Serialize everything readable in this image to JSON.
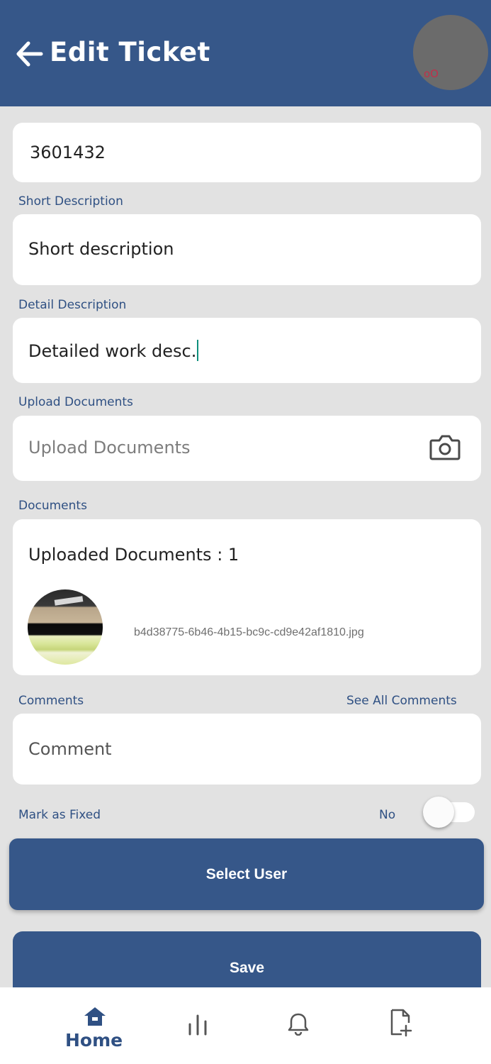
{
  "header": {
    "title": "Edit Ticket",
    "back_icon": "arrow-left-icon",
    "avatar_mark": "oO",
    "bg_color": "#365789"
  },
  "form": {
    "ticket_number": "3601432",
    "short_description": {
      "label": "Short Description",
      "value": "Short description"
    },
    "detail_description": {
      "label": "Detail Description",
      "value": "Detailed work desc."
    },
    "upload": {
      "label": "Upload Documents",
      "placeholder": "Upload Documents",
      "icon": "camera-icon"
    },
    "documents": {
      "label": "Documents",
      "heading": "Uploaded Documents : 1",
      "files": [
        {
          "name": "b4d38775-6b46-4b15-bc9c-cd9e42af1810.jpg"
        }
      ]
    },
    "comments": {
      "label": "Comments",
      "see_all_link": "See All Comments",
      "placeholder": "Comment"
    },
    "mark_fixed": {
      "label": "Mark as Fixed",
      "state_text": "No",
      "checked": false
    }
  },
  "buttons": {
    "select_user": "Select User",
    "save": "Save"
  },
  "bottom_nav": {
    "items": [
      {
        "label": "Home",
        "icon": "home-icon",
        "active": true
      },
      {
        "label": "",
        "icon": "bar-chart-icon",
        "active": false
      },
      {
        "label": "",
        "icon": "bell-icon",
        "active": false
      },
      {
        "label": "",
        "icon": "add-file-icon",
        "active": false
      }
    ]
  },
  "colors": {
    "primary": "#365789",
    "background": "#e2e2e2",
    "label": "#2f5083"
  }
}
